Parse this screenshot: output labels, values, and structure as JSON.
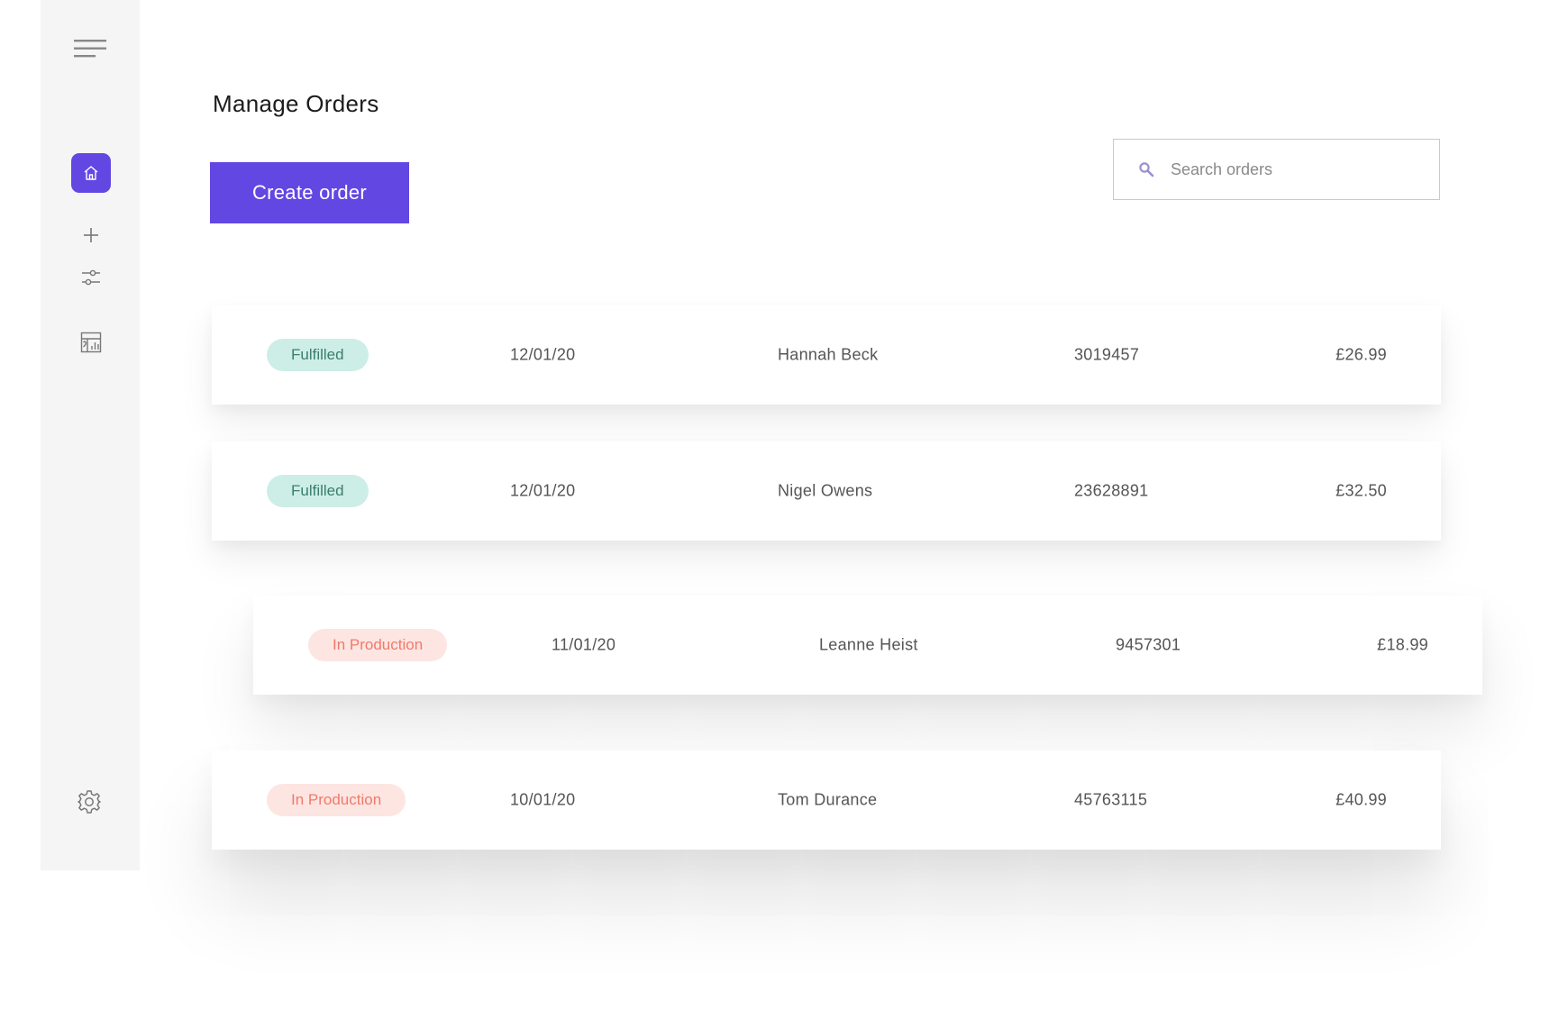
{
  "sidebar": {
    "icons": [
      "menu-icon",
      "home-icon",
      "plus-icon",
      "sliders-icon",
      "report-icon",
      "gear-icon"
    ],
    "accent_color": "#6347e3"
  },
  "header": {
    "title": "Manage Orders",
    "create_label": "Create order"
  },
  "search": {
    "placeholder": "Search orders",
    "value": ""
  },
  "status_colors": {
    "fulfilled_bg": "#cdeee7",
    "fulfilled_text": "#3b7d6f",
    "production_bg": "#fde5e2",
    "production_text": "#f07a6a"
  },
  "orders": [
    {
      "status": "Fulfilled",
      "date": "12/01/20",
      "customer": "Hannah Beck",
      "order_id": "3019457",
      "price": "£26.99"
    },
    {
      "status": "Fulfilled",
      "date": "12/01/20",
      "customer": "Nigel Owens",
      "order_id": "23628891",
      "price": "£32.50"
    },
    {
      "status": "In Production",
      "date": "11/01/20",
      "customer": "Leanne Heist",
      "order_id": "9457301",
      "price": "£18.99"
    },
    {
      "status": "In Production",
      "date": "10/01/20",
      "customer": "Tom Durance",
      "order_id": "45763115",
      "price": "£40.99"
    }
  ]
}
